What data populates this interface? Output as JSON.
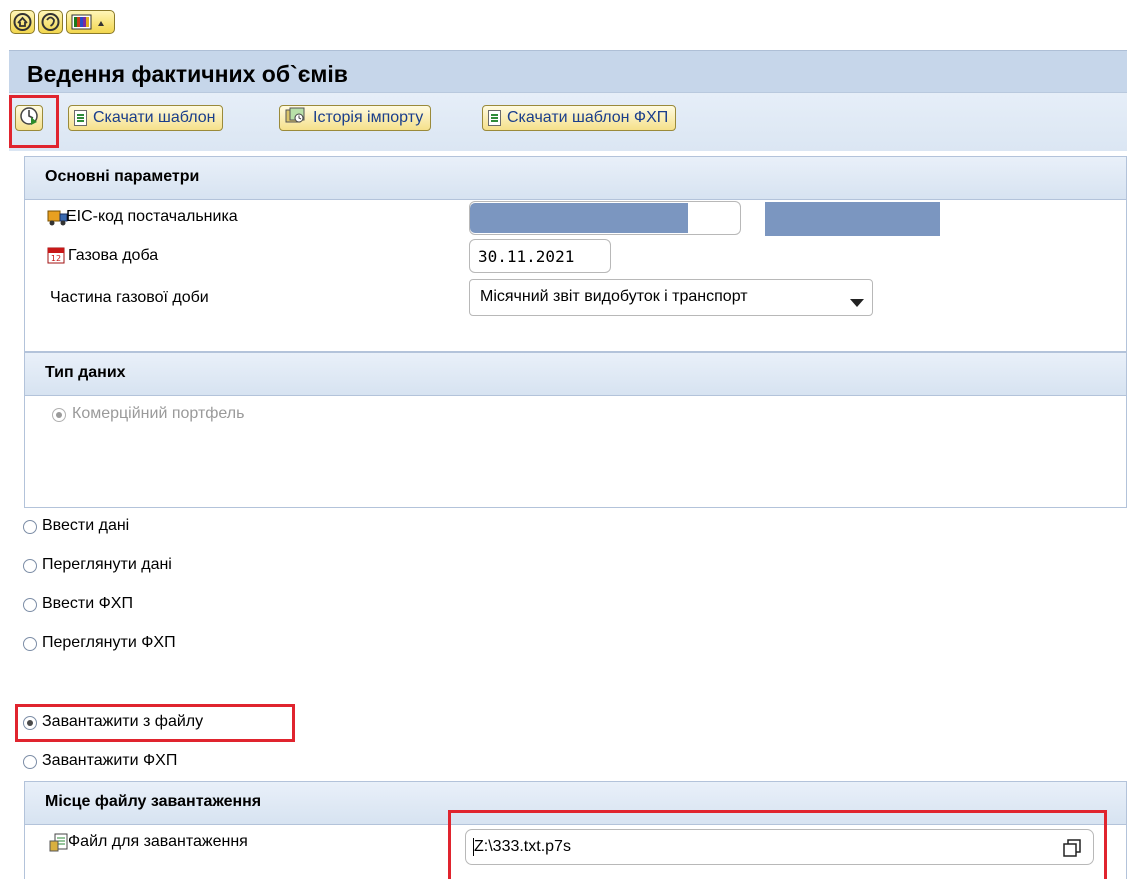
{
  "app": {
    "title": "Ведення фактичних об`ємів"
  },
  "system_toolbar": {
    "icons": [
      "home-icon",
      "favorites-icon",
      "layout-menu-icon"
    ]
  },
  "app_toolbar": {
    "buttons": [
      {
        "label": "",
        "icon": "execute-icon"
      },
      {
        "label": "Скачати шаблон",
        "icon": "document-icon"
      },
      {
        "label": "Історія імпорту",
        "icon": "history-icon"
      },
      {
        "label": "Скачати шаблон ФХП",
        "icon": "document-icon"
      }
    ]
  },
  "main_params": {
    "title": "Основні параметри",
    "supplier_eic_label": "EIC-код постачальника",
    "gas_day_label": "Газова доба",
    "gas_day_value": "30.11.2021",
    "gas_day_part_label": "Частина газової доби",
    "gas_day_part_value": "Місячний звіт видобуток і транспорт"
  },
  "data_type": {
    "title": "Тип даних",
    "option": "Комерційний портфель"
  },
  "actions": {
    "options": [
      "Ввести дані",
      "Переглянути дані",
      "Ввести ФХП",
      "Переглянути ФХП",
      "Завантажити з файлу",
      "Завантажити ФХП"
    ],
    "selected": "Завантажити з файлу"
  },
  "file_location": {
    "title": "Місце файлу завантаження",
    "file_label": "Файл для завантаження",
    "file_value": "Z:\\333.txt.p7s"
  },
  "colors": {
    "highlight_red": "#e0242e",
    "header_blue": "#c6d6ea",
    "redacted_blue": "#7b96c0",
    "link_blue": "#1a3e8c"
  }
}
